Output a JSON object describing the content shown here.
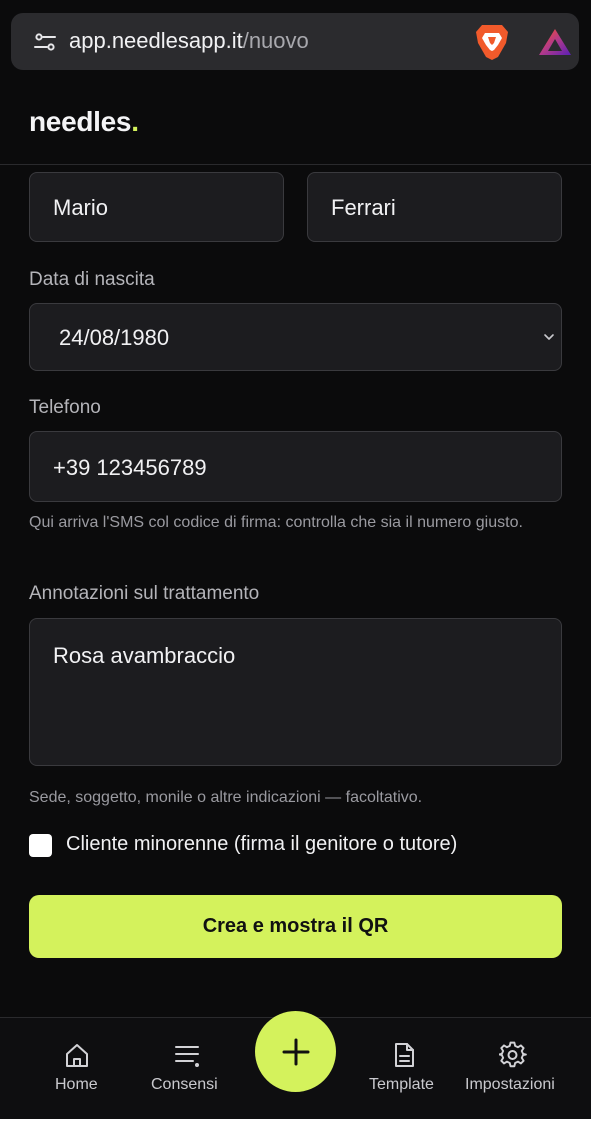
{
  "browser": {
    "url_host": "app.needlesapp.it",
    "url_path": "/nuovo",
    "tune_icon": "tune-icon",
    "brave_icon": "brave-lion-icon",
    "rewards_icon": "triangle-rewards-icon"
  },
  "app": {
    "logo_text": "needles",
    "logo_dot": ".",
    "accent": "#d4f25c"
  },
  "form": {
    "first_name": "Mario",
    "last_name": "Ferrari",
    "birthdate_label": "Data di nascita",
    "birthdate_value": "24/08/1980",
    "phone_label": "Telefono",
    "phone_value": "+39 123456789",
    "phone_hint": "Qui arriva l'SMS col codice di firma: controlla che sia il numero giusto.",
    "notes_label": "Annotazioni sul trattamento",
    "notes_value": "Rosa avambraccio",
    "notes_hint": "Sede, soggetto, monile o altre indicazioni — facoltativo.",
    "minor_label": "Cliente minorenne (firma il genitore o tutore)",
    "minor_checked": false,
    "submit_label": "Crea e mostra il QR"
  },
  "nav": {
    "items": [
      {
        "label": "Home",
        "icon": "home-icon"
      },
      {
        "label": "Consensi",
        "icon": "list-icon"
      },
      {
        "label": "Template",
        "icon": "document-icon"
      },
      {
        "label": "Impostazioni",
        "icon": "gear-icon"
      }
    ],
    "fab_icon": "plus-icon"
  }
}
